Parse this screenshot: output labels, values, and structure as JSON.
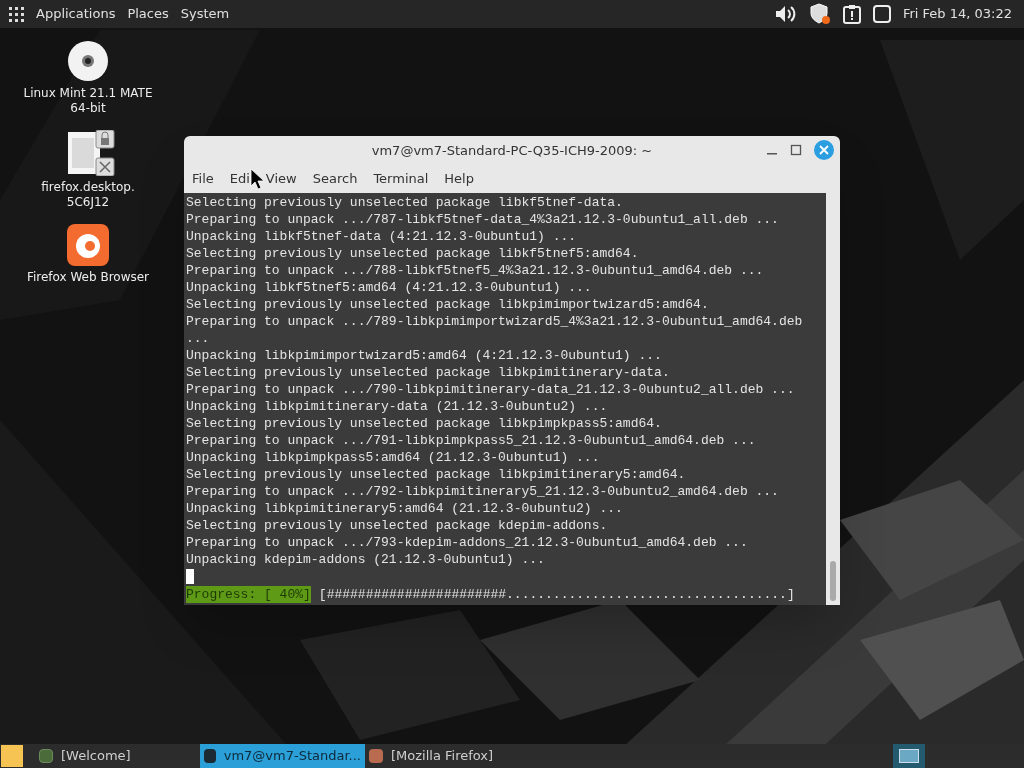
{
  "top_panel": {
    "menus": [
      "Applications",
      "Places",
      "System"
    ],
    "clock": "Fri Feb 14, 03:22"
  },
  "desktop_icons": [
    {
      "kind": "disc",
      "label": "Linux Mint 21.1 MATE 64-bit"
    },
    {
      "kind": "file",
      "label": "firefox.desktop. 5C6J12"
    },
    {
      "kind": "browser",
      "label": "Firefox Web Browser"
    }
  ],
  "terminal": {
    "title": "vm7@vm7-Standard-PC-Q35-ICH9-2009: ~",
    "menu": [
      "File",
      "Edi",
      "View",
      "Search",
      "Terminal",
      "Help"
    ],
    "lines": [
      "Selecting previously unselected package libkf5tnef-data.",
      "Preparing to unpack .../787-libkf5tnef-data_4%3a21.12.3-0ubuntu1_all.deb ...",
      "Unpacking libkf5tnef-data (4:21.12.3-0ubuntu1) ...",
      "Selecting previously unselected package libkf5tnef5:amd64.",
      "Preparing to unpack .../788-libkf5tnef5_4%3a21.12.3-0ubuntu1_amd64.deb ...",
      "Unpacking libkf5tnef5:amd64 (4:21.12.3-0ubuntu1) ...",
      "Selecting previously unselected package libkpimimportwizard5:amd64.",
      "Preparing to unpack .../789-libkpimimportwizard5_4%3a21.12.3-0ubuntu1_amd64.deb",
      "...",
      "Unpacking libkpimimportwizard5:amd64 (4:21.12.3-0ubuntu1) ...",
      "Selecting previously unselected package libkpimitinerary-data.",
      "Preparing to unpack .../790-libkpimitinerary-data_21.12.3-0ubuntu2_all.deb ...",
      "Unpacking libkpimitinerary-data (21.12.3-0ubuntu2) ...",
      "Selecting previously unselected package libkpimpkpass5:amd64.",
      "Preparing to unpack .../791-libkpimpkpass5_21.12.3-0ubuntu1_amd64.deb ...",
      "Unpacking libkpimpkpass5:amd64 (21.12.3-0ubuntu1) ...",
      "Selecting previously unselected package libkpimitinerary5:amd64.",
      "Preparing to unpack .../792-libkpimitinerary5_21.12.3-0ubuntu2_amd64.deb ...",
      "Unpacking libkpimitinerary5:amd64 (21.12.3-0ubuntu2) ...",
      "Selecting previously unselected package kdepim-addons.",
      "Preparing to unpack .../793-kdepim-addons_21.12.3-0ubuntu1_amd64.deb ...",
      "Unpacking kdepim-addons (21.12.3-0ubuntu1) ..."
    ],
    "progress": {
      "label": "Progress: [ 40%]",
      "bar": "[#######################....................................]"
    }
  },
  "taskbar": {
    "items": [
      {
        "kind": "app",
        "label": "[Welcome]",
        "selected": false
      },
      {
        "kind": "terminal",
        "label": "vm7@vm7-Standar...",
        "selected": true
      },
      {
        "kind": "browser",
        "label": "[Mozilla Firefox]",
        "selected": false
      }
    ]
  }
}
